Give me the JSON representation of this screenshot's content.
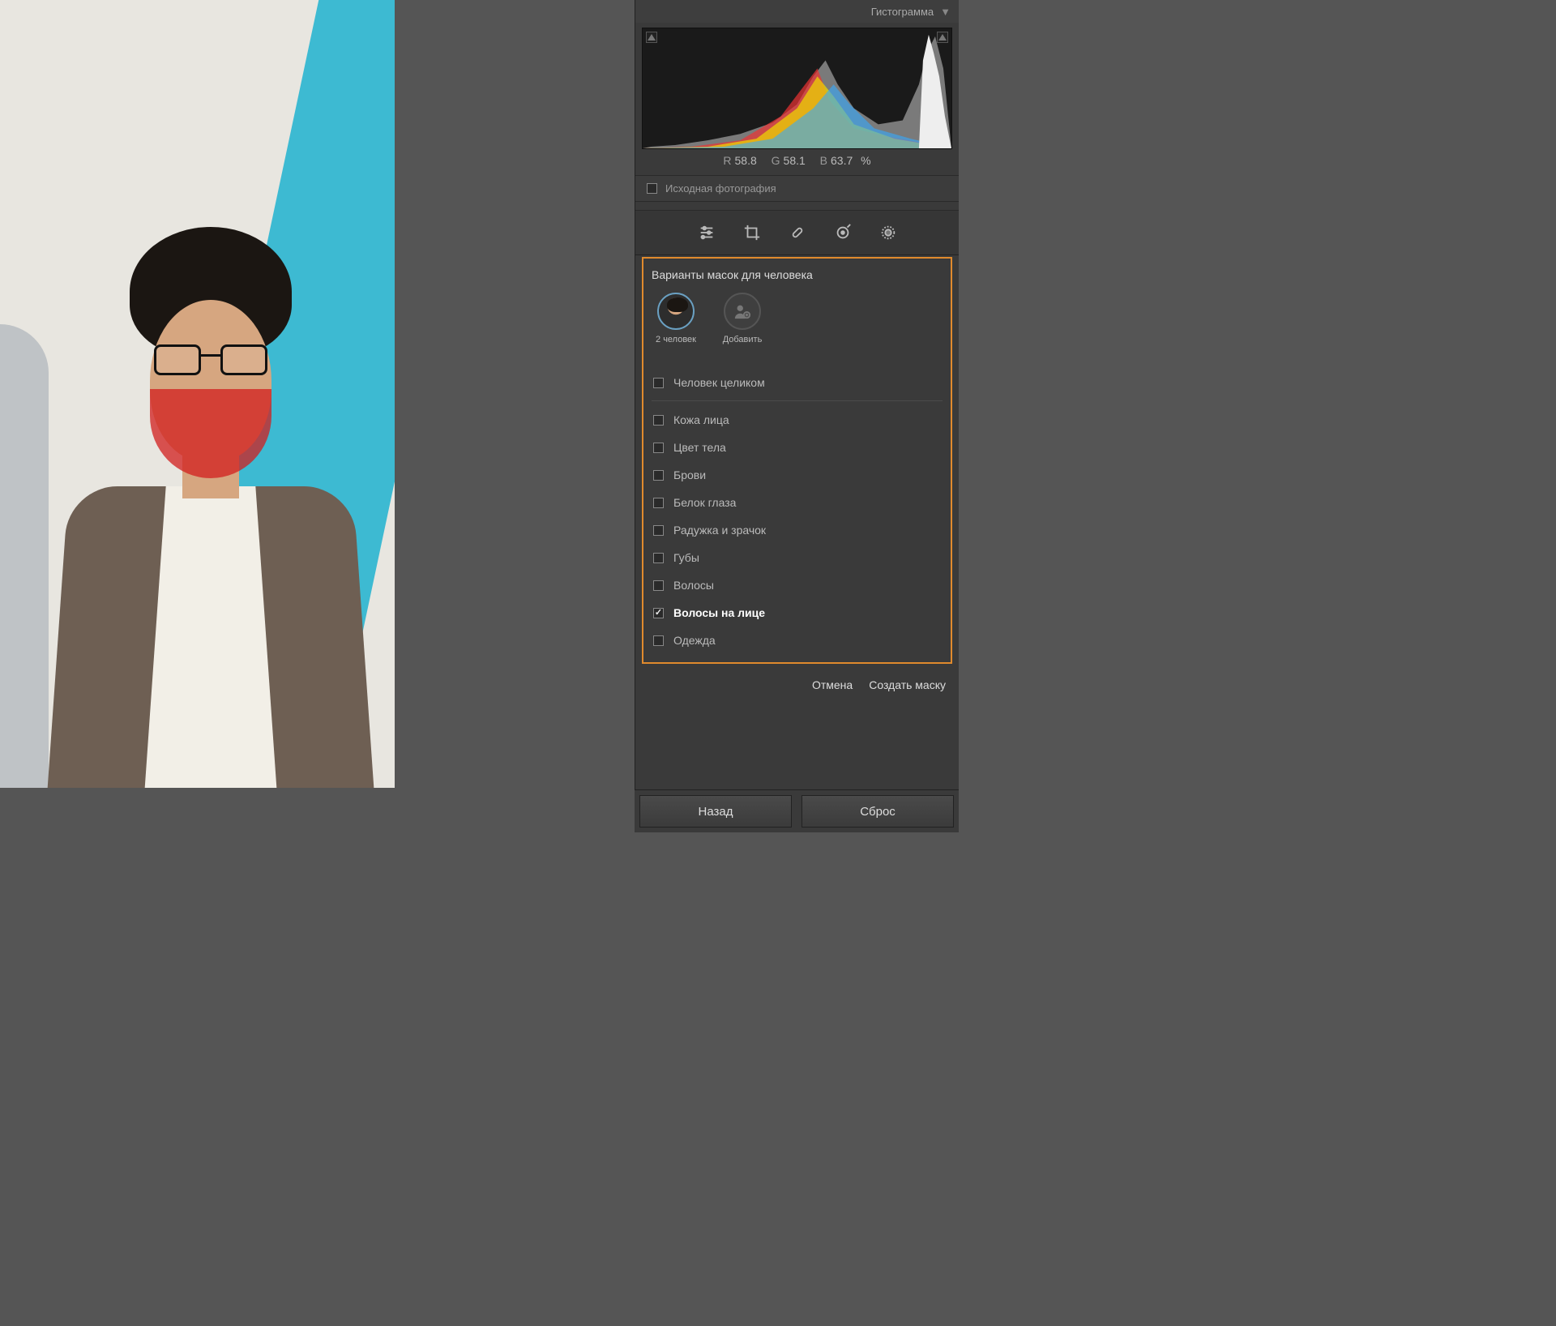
{
  "panel": {
    "histogram_title": "Гистограмма",
    "readout": {
      "r_label": "R",
      "r": "58.8",
      "g_label": "G",
      "g": "58.1",
      "b_label": "B",
      "b": "63.7",
      "pct": "%"
    },
    "original_photo": "Исходная фотография"
  },
  "mask": {
    "title": "Варианты масок для человека",
    "people": [
      {
        "label": "2 человек"
      },
      {
        "label": "Добавить"
      }
    ],
    "options": {
      "whole": {
        "label": "Человек целиком",
        "checked": false
      },
      "items": [
        {
          "label": "Кожа лица",
          "checked": false
        },
        {
          "label": "Цвет тела",
          "checked": false
        },
        {
          "label": "Брови",
          "checked": false
        },
        {
          "label": "Белок глаза",
          "checked": false
        },
        {
          "label": "Радужка и зрачок",
          "checked": false
        },
        {
          "label": "Губы",
          "checked": false
        },
        {
          "label": "Волосы",
          "checked": false
        },
        {
          "label": "Волосы на лице",
          "checked": true
        },
        {
          "label": "Одежда",
          "checked": false
        }
      ]
    },
    "cancel": "Отмена",
    "create": "Создать маску"
  },
  "footer": {
    "back": "Назад",
    "reset": "Сброс"
  }
}
